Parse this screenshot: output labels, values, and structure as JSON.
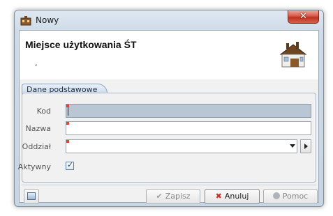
{
  "window": {
    "title": "Nowy",
    "close_symbol": "✕",
    "app_icon": "building-icon"
  },
  "header": {
    "title": "Miejsce użytkowania ŚT",
    "subtitle": ",",
    "icon": "house-icon"
  },
  "group": {
    "tab_label": "Dane podstawowe"
  },
  "form": {
    "kod": {
      "label": "Kod",
      "value": ""
    },
    "nazwa": {
      "label": "Nazwa",
      "value": ""
    },
    "oddzial": {
      "label": "Oddział",
      "value": ""
    },
    "aktywny": {
      "label": "Aktywny",
      "checked": true
    }
  },
  "footer": {
    "save_label": "Zapisz",
    "cancel_label": "Anuluj",
    "help_label": "Pomoc"
  },
  "colors": {
    "required_marker": "#e0453a",
    "focused_field": "#b9c6d3",
    "cancel_icon": "#c8312a"
  }
}
